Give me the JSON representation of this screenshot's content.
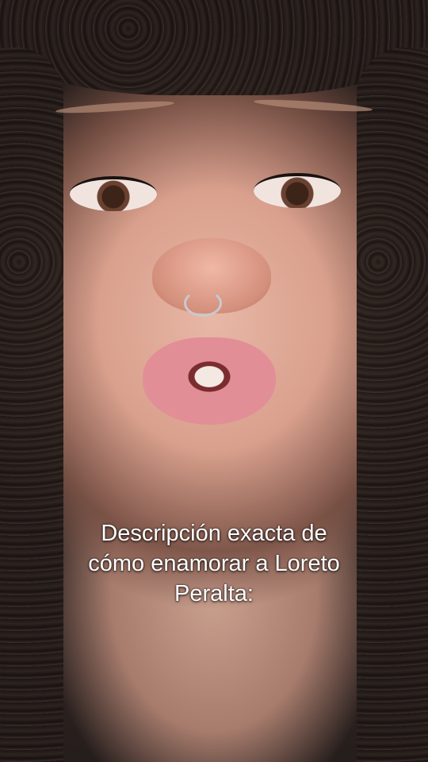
{
  "caption": {
    "line1": "Descripción exacta de",
    "line2": "cómo enamorar a Loreto",
    "line3": "Peralta:"
  }
}
